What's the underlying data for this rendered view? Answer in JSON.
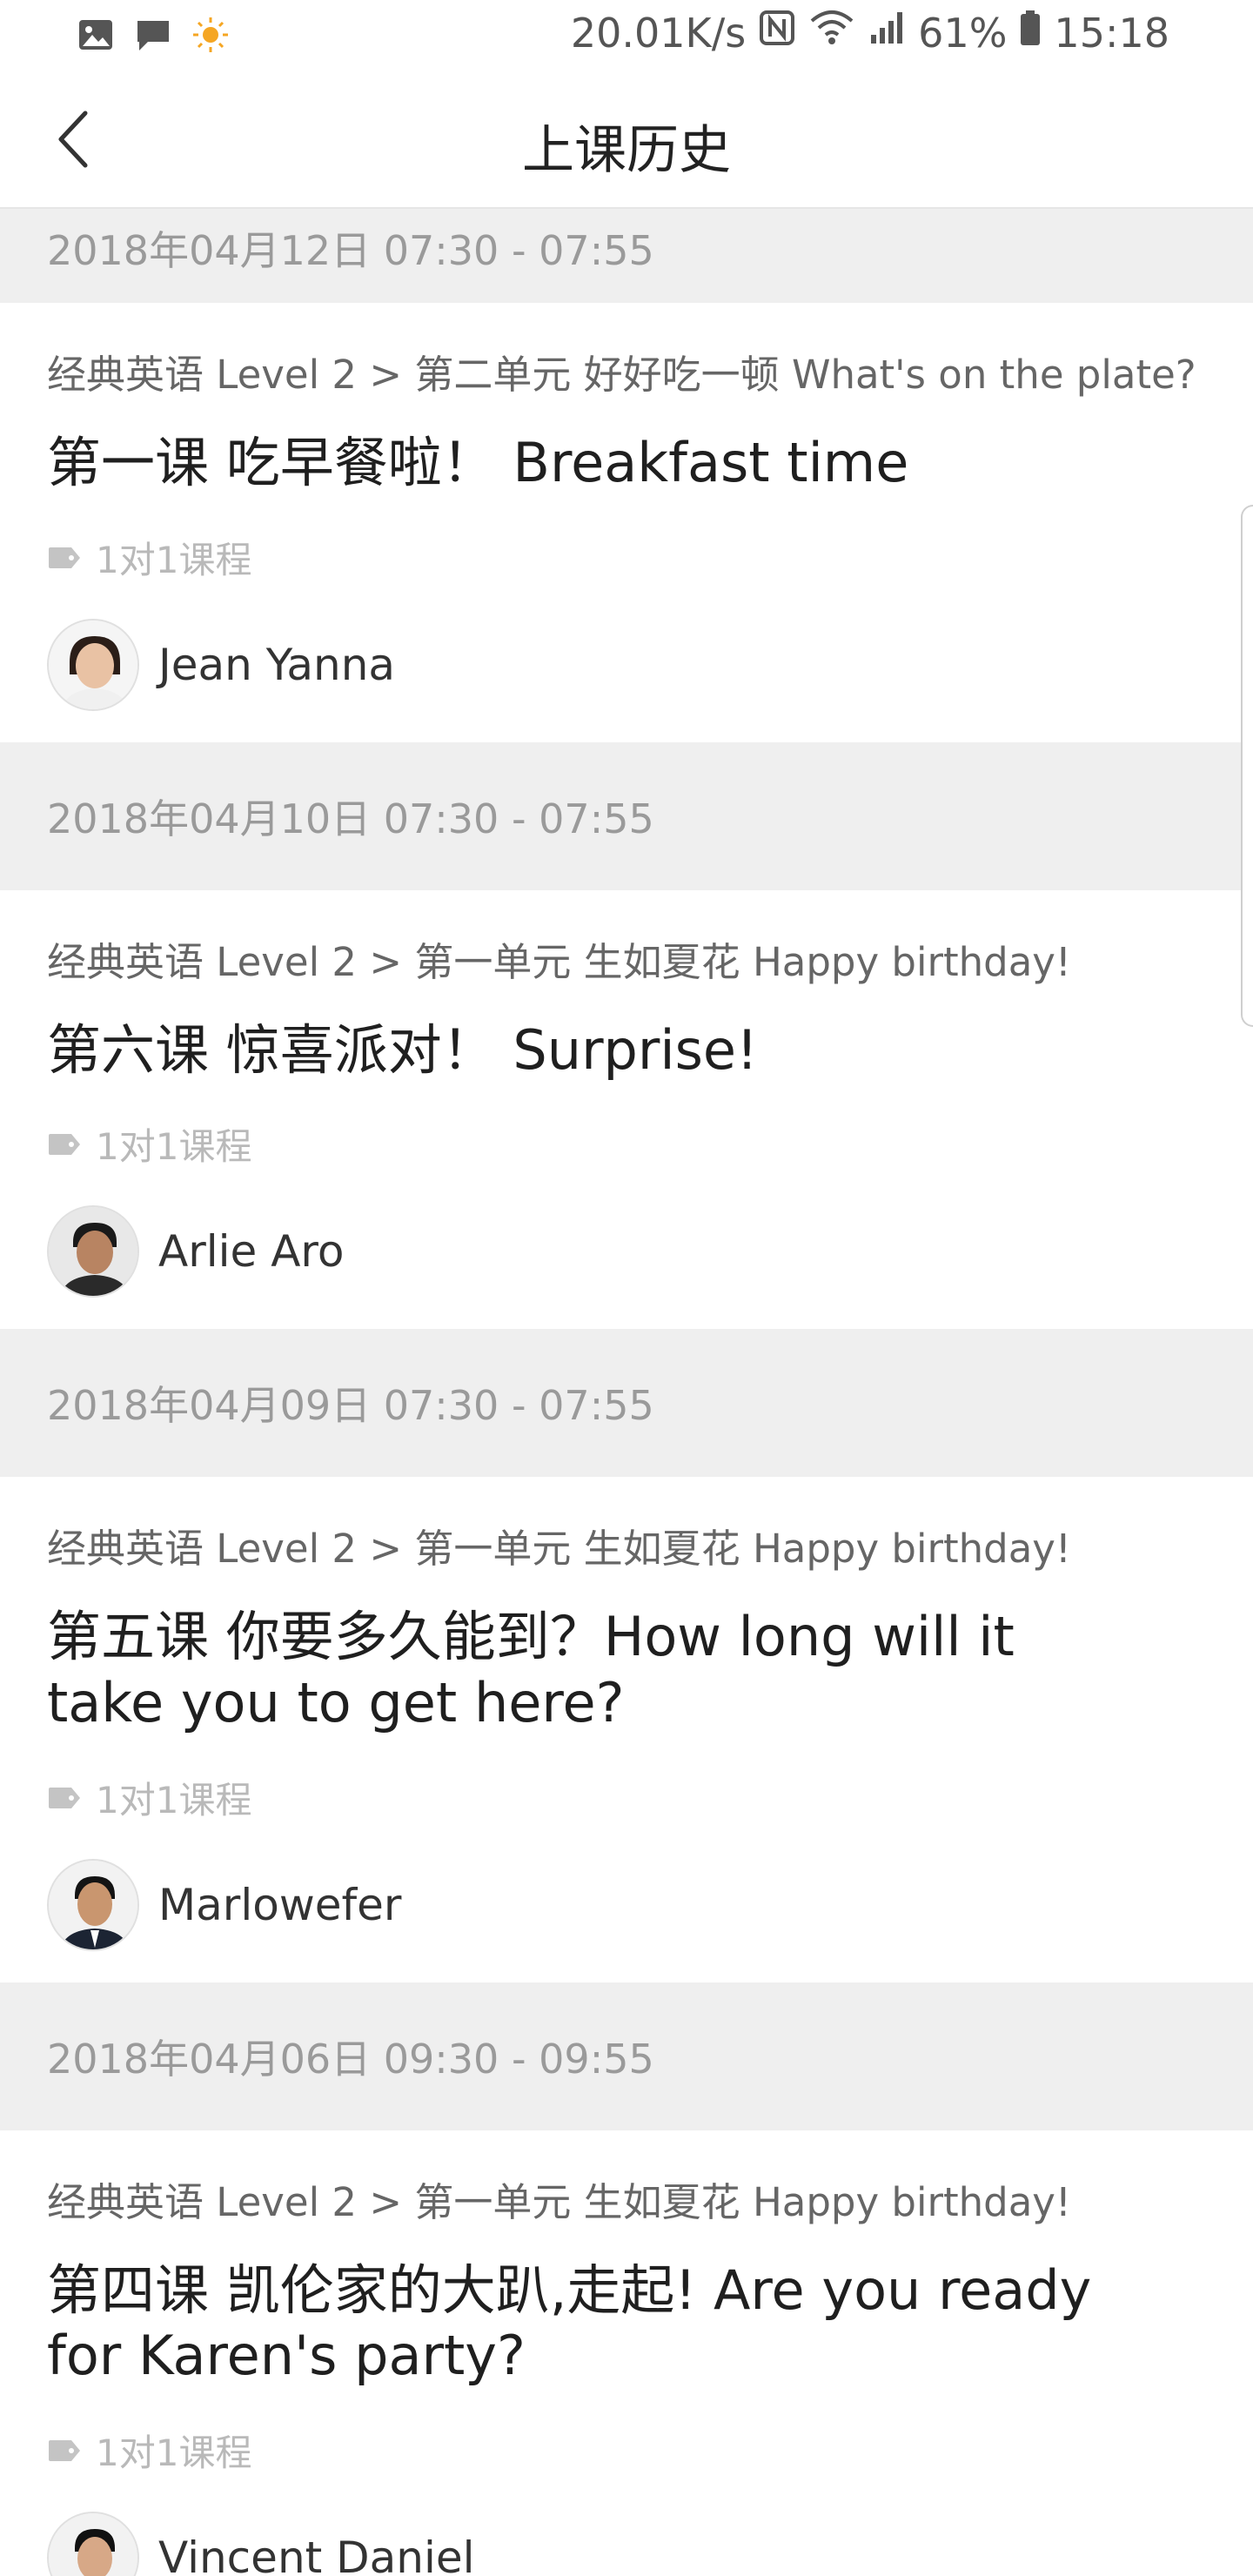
{
  "status_bar": {
    "net_speed": "20.01K/s",
    "battery": "61%",
    "time": "15:18",
    "icons": [
      "image-icon",
      "chat-icon",
      "sun-icon",
      "nfc-icon",
      "wifi-icon",
      "signal-icon",
      "battery-icon"
    ]
  },
  "header": {
    "title": "上课历史"
  },
  "lessons": [
    {
      "date": "2018年04月12日 07:30 - 07:55",
      "breadcrumb": "经典英语 Level 2 > 第二单元 好好吃一顿 What's on the plate?",
      "title": "第一课 吃早餐啦！ Breakfast time",
      "tag": "1对1课程",
      "teacher": "Jean Yanna"
    },
    {
      "date": "2018年04月10日 07:30 - 07:55",
      "breadcrumb": "经典英语 Level 2 > 第一单元 生如夏花 Happy birthday!",
      "title": "第六课 惊喜派对！ Surprise!",
      "tag": "1对1课程",
      "teacher": "Arlie Aro"
    },
    {
      "date": "2018年04月09日 07:30 - 07:55",
      "breadcrumb": "经典英语 Level 2 > 第一单元 生如夏花 Happy birthday!",
      "title": "第五课 你要多久能到？How long will it take you to get here?",
      "tag": "1对1课程",
      "teacher": "Marlowefer"
    },
    {
      "date": "2018年04月06日 09:30 - 09:55",
      "breadcrumb": "经典英语 Level 2 > 第一单元 生如夏花 Happy birthday!",
      "title": "第四课 凯伦家的大趴,走起! Are you ready for Karen's party?",
      "tag": "1对1课程",
      "teacher": "Vincent Daniel"
    }
  ]
}
